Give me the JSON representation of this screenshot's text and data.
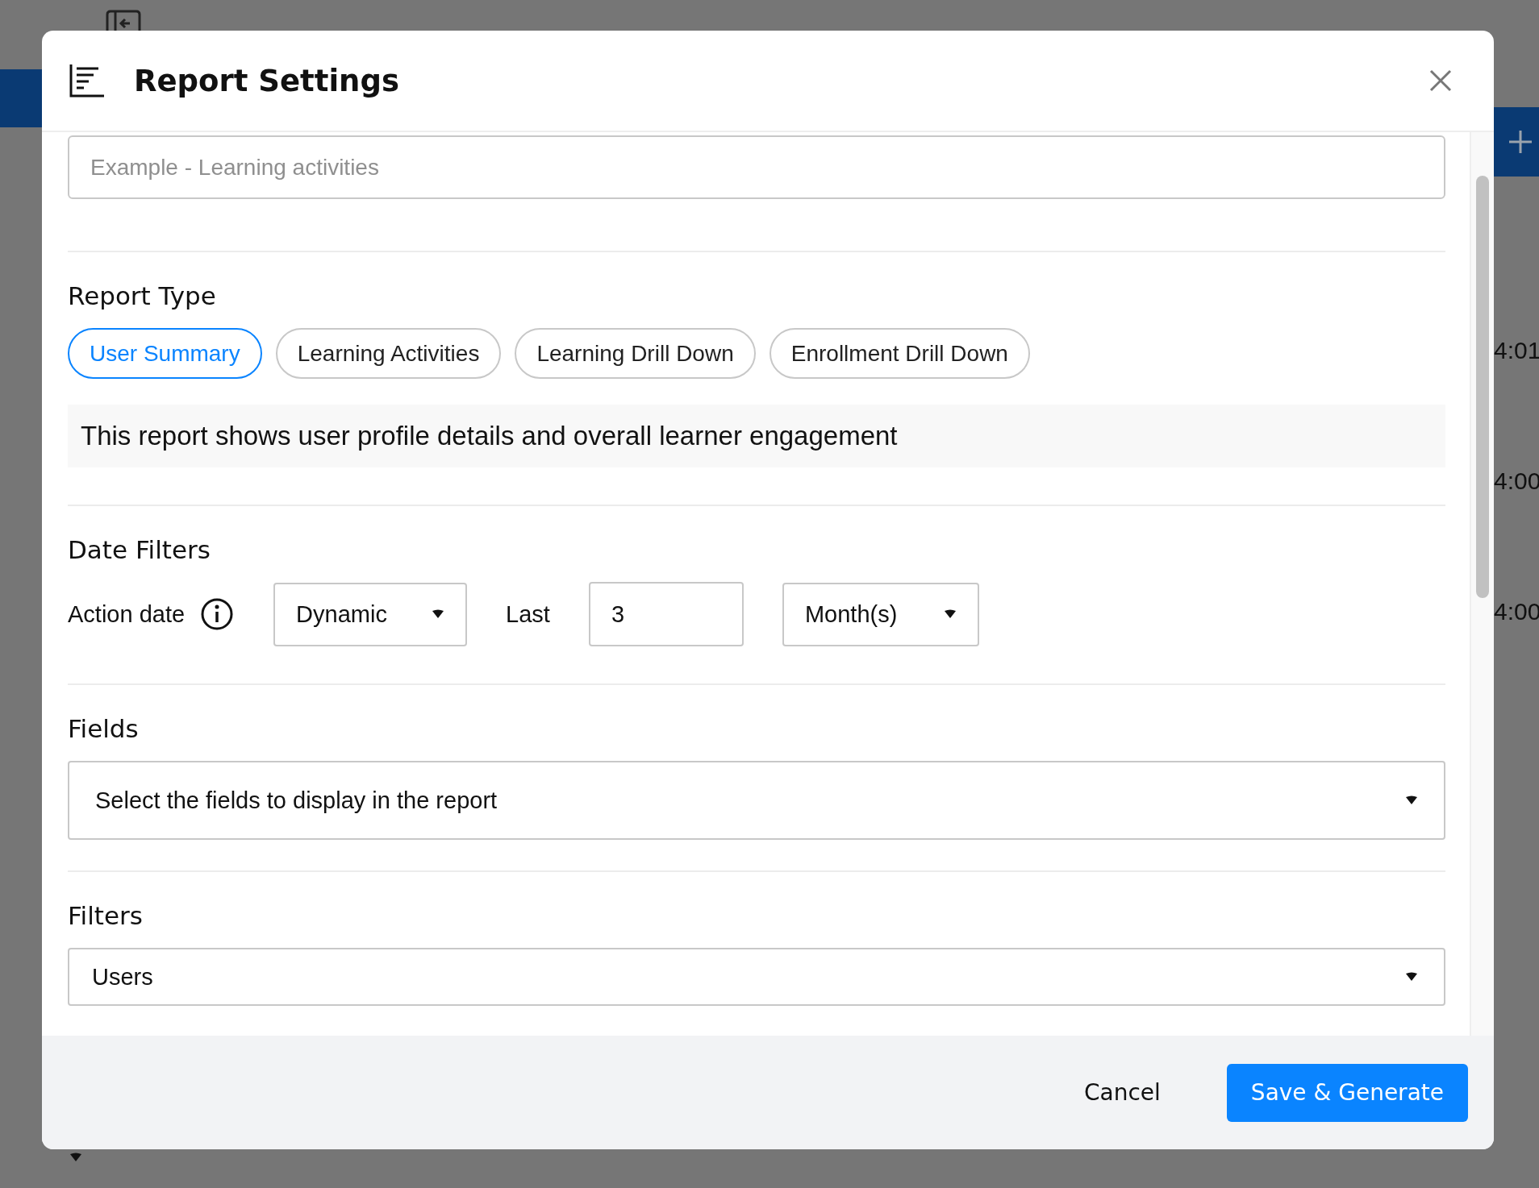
{
  "background": {
    "time_labels": [
      "4:01",
      "4:00",
      "4:00"
    ]
  },
  "dialog": {
    "title": "Report Settings"
  },
  "name_field": {
    "placeholder": "Example - Learning activities"
  },
  "report_type": {
    "heading": "Report Type",
    "options": [
      {
        "label": "User Summary",
        "selected": true
      },
      {
        "label": "Learning Activities",
        "selected": false
      },
      {
        "label": "Learning Drill Down",
        "selected": false
      },
      {
        "label": "Enrollment Drill Down",
        "selected": false
      }
    ],
    "description": "This report shows user profile details and overall learner engagement"
  },
  "date_filters": {
    "heading": "Date Filters",
    "label": "Action date",
    "mode": "Dynamic",
    "last_label": "Last",
    "amount": "3",
    "unit": "Month(s)"
  },
  "fields": {
    "heading": "Fields",
    "prompt": "Select the fields to display in the report"
  },
  "filters": {
    "heading": "Filters",
    "value": "Users"
  },
  "footer": {
    "cancel": "Cancel",
    "submit": "Save & Generate"
  }
}
